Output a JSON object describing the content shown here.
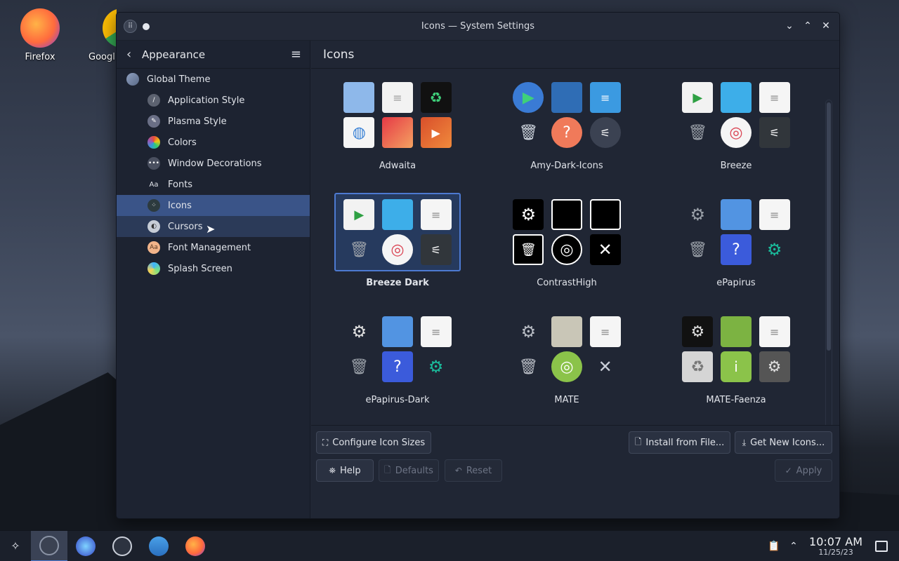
{
  "desktop": {
    "icons": [
      {
        "label": "Firefox"
      },
      {
        "label": "Googl"
      }
    ]
  },
  "window": {
    "title": "Icons — System Settings"
  },
  "sidebar": {
    "header": "Appearance",
    "items": [
      {
        "label": "Global Theme"
      },
      {
        "label": "Application Style"
      },
      {
        "label": "Plasma Style"
      },
      {
        "label": "Colors"
      },
      {
        "label": "Window Decorations"
      },
      {
        "label": "Fonts"
      },
      {
        "label": "Icons"
      },
      {
        "label": "Cursors"
      },
      {
        "label": "Font Management"
      },
      {
        "label": "Splash Screen"
      }
    ]
  },
  "main": {
    "title": "Icons",
    "themes": [
      {
        "name": "Adwaita"
      },
      {
        "name": "Amy-Dark-Icons"
      },
      {
        "name": "Breeze"
      },
      {
        "name": "Breeze Dark"
      },
      {
        "name": "ContrastHigh"
      },
      {
        "name": "ePapirus"
      },
      {
        "name": "ePapirus-Dark"
      },
      {
        "name": "MATE"
      },
      {
        "name": "MATE-Faenza"
      }
    ]
  },
  "footer": {
    "configure_sizes": "Configure Icon Sizes",
    "install_from_file": "Install from File...",
    "get_new": "Get New Icons...",
    "help": "Help",
    "defaults": "Defaults",
    "reset": "Reset",
    "apply": "Apply"
  },
  "taskbar": {
    "time": "10:07 AM",
    "date": "11/25/23"
  }
}
